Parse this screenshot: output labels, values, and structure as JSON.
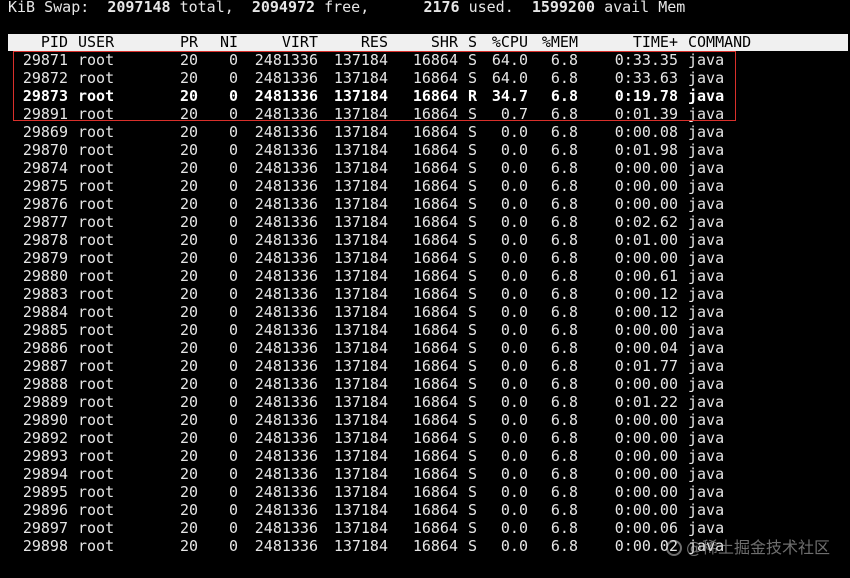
{
  "swap": {
    "label": "KiB Swap:",
    "total": "2097148",
    "total_label": "total,",
    "free": "2094972",
    "free_label": "free,",
    "used": "2176",
    "used_label": "used.",
    "avail": "1599200",
    "avail_label": "avail Mem"
  },
  "columns": [
    "PID",
    "USER",
    "PR",
    "NI",
    "VIRT",
    "RES",
    "SHR",
    "S",
    "%CPU",
    "%MEM",
    "TIME+",
    "COMMAND"
  ],
  "processes": [
    [
      "29871",
      "root",
      "20",
      "0",
      "2481336",
      "137184",
      "16864",
      "S",
      "64.0",
      "6.8",
      "0:33.35",
      "java"
    ],
    [
      "29872",
      "root",
      "20",
      "0",
      "2481336",
      "137184",
      "16864",
      "S",
      "64.0",
      "6.8",
      "0:33.63",
      "java"
    ],
    [
      "29873",
      "root",
      "20",
      "0",
      "2481336",
      "137184",
      "16864",
      "R",
      "34.7",
      "6.8",
      "0:19.78",
      "java"
    ],
    [
      "29891",
      "root",
      "20",
      "0",
      "2481336",
      "137184",
      "16864",
      "S",
      "0.7",
      "6.8",
      "0:01.39",
      "java"
    ],
    [
      "29869",
      "root",
      "20",
      "0",
      "2481336",
      "137184",
      "16864",
      "S",
      "0.0",
      "6.8",
      "0:00.08",
      "java"
    ],
    [
      "29870",
      "root",
      "20",
      "0",
      "2481336",
      "137184",
      "16864",
      "S",
      "0.0",
      "6.8",
      "0:01.98",
      "java"
    ],
    [
      "29874",
      "root",
      "20",
      "0",
      "2481336",
      "137184",
      "16864",
      "S",
      "0.0",
      "6.8",
      "0:00.00",
      "java"
    ],
    [
      "29875",
      "root",
      "20",
      "0",
      "2481336",
      "137184",
      "16864",
      "S",
      "0.0",
      "6.8",
      "0:00.00",
      "java"
    ],
    [
      "29876",
      "root",
      "20",
      "0",
      "2481336",
      "137184",
      "16864",
      "S",
      "0.0",
      "6.8",
      "0:00.00",
      "java"
    ],
    [
      "29877",
      "root",
      "20",
      "0",
      "2481336",
      "137184",
      "16864",
      "S",
      "0.0",
      "6.8",
      "0:02.62",
      "java"
    ],
    [
      "29878",
      "root",
      "20",
      "0",
      "2481336",
      "137184",
      "16864",
      "S",
      "0.0",
      "6.8",
      "0:01.00",
      "java"
    ],
    [
      "29879",
      "root",
      "20",
      "0",
      "2481336",
      "137184",
      "16864",
      "S",
      "0.0",
      "6.8",
      "0:00.00",
      "java"
    ],
    [
      "29880",
      "root",
      "20",
      "0",
      "2481336",
      "137184",
      "16864",
      "S",
      "0.0",
      "6.8",
      "0:00.61",
      "java"
    ],
    [
      "29883",
      "root",
      "20",
      "0",
      "2481336",
      "137184",
      "16864",
      "S",
      "0.0",
      "6.8",
      "0:00.12",
      "java"
    ],
    [
      "29884",
      "root",
      "20",
      "0",
      "2481336",
      "137184",
      "16864",
      "S",
      "0.0",
      "6.8",
      "0:00.12",
      "java"
    ],
    [
      "29885",
      "root",
      "20",
      "0",
      "2481336",
      "137184",
      "16864",
      "S",
      "0.0",
      "6.8",
      "0:00.00",
      "java"
    ],
    [
      "29886",
      "root",
      "20",
      "0",
      "2481336",
      "137184",
      "16864",
      "S",
      "0.0",
      "6.8",
      "0:00.04",
      "java"
    ],
    [
      "29887",
      "root",
      "20",
      "0",
      "2481336",
      "137184",
      "16864",
      "S",
      "0.0",
      "6.8",
      "0:01.77",
      "java"
    ],
    [
      "29888",
      "root",
      "20",
      "0",
      "2481336",
      "137184",
      "16864",
      "S",
      "0.0",
      "6.8",
      "0:00.00",
      "java"
    ],
    [
      "29889",
      "root",
      "20",
      "0",
      "2481336",
      "137184",
      "16864",
      "S",
      "0.0",
      "6.8",
      "0:01.22",
      "java"
    ],
    [
      "29890",
      "root",
      "20",
      "0",
      "2481336",
      "137184",
      "16864",
      "S",
      "0.0",
      "6.8",
      "0:00.00",
      "java"
    ],
    [
      "29892",
      "root",
      "20",
      "0",
      "2481336",
      "137184",
      "16864",
      "S",
      "0.0",
      "6.8",
      "0:00.00",
      "java"
    ],
    [
      "29893",
      "root",
      "20",
      "0",
      "2481336",
      "137184",
      "16864",
      "S",
      "0.0",
      "6.8",
      "0:00.00",
      "java"
    ],
    [
      "29894",
      "root",
      "20",
      "0",
      "2481336",
      "137184",
      "16864",
      "S",
      "0.0",
      "6.8",
      "0:00.00",
      "java"
    ],
    [
      "29895",
      "root",
      "20",
      "0",
      "2481336",
      "137184",
      "16864",
      "S",
      "0.0",
      "6.8",
      "0:00.00",
      "java"
    ],
    [
      "29896",
      "root",
      "20",
      "0",
      "2481336",
      "137184",
      "16864",
      "S",
      "0.0",
      "6.8",
      "0:00.00",
      "java"
    ],
    [
      "29897",
      "root",
      "20",
      "0",
      "2481336",
      "137184",
      "16864",
      "S",
      "0.0",
      "6.8",
      "0:00.06",
      "java"
    ],
    [
      "29898",
      "root",
      "20",
      "0",
      "2481336",
      "137184",
      "16864",
      "S",
      "0.0",
      "6.8",
      "0:00.02",
      "java"
    ]
  ],
  "watermark": {
    "icon": "juejin-logo-icon",
    "text": "@稀土掘金技术社区"
  },
  "colors": {
    "background": "#000000",
    "text": "#e6e6e6",
    "header_bg": "#f0f0f0",
    "highlight_border": "#d9302b"
  }
}
